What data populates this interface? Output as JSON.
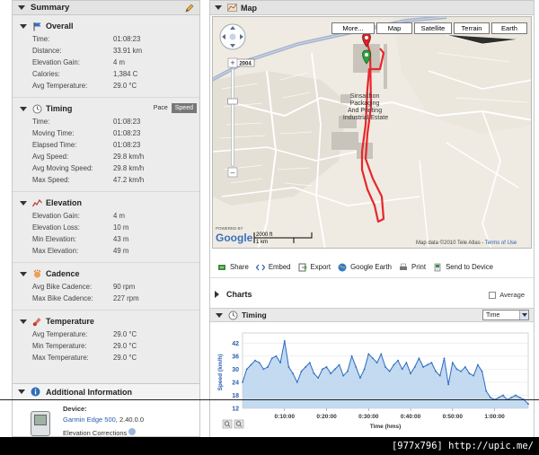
{
  "summary": {
    "title": "Summary",
    "sections": [
      {
        "title": "Overall",
        "icon": "flag-icon",
        "rows": [
          {
            "label": "Time:",
            "value": "01:08:23"
          },
          {
            "label": "Distance:",
            "value": "33.91 km"
          },
          {
            "label": "Elevation Gain:",
            "value": "4 m"
          },
          {
            "label": "Calories:",
            "value": "1,384 C"
          },
          {
            "label": "Avg Temperature:",
            "value": "29.0 °C"
          }
        ]
      },
      {
        "title": "Timing",
        "icon": "clock-icon",
        "toggle": {
          "pace": "Pace",
          "speed": "Speed"
        },
        "rows": [
          {
            "label": "Time:",
            "value": "01:08:23"
          },
          {
            "label": "Moving Time:",
            "value": "01:08:23"
          },
          {
            "label": "Elapsed Time:",
            "value": "01:08:23"
          },
          {
            "label": "Avg Speed:",
            "value": "29.8 km/h"
          },
          {
            "label": "Avg Moving Speed:",
            "value": "29.8 km/h"
          },
          {
            "label": "Max Speed:",
            "value": "47.2 km/h"
          }
        ]
      },
      {
        "title": "Elevation",
        "icon": "elevation-icon",
        "rows": [
          {
            "label": "Elevation Gain:",
            "value": "4 m"
          },
          {
            "label": "Elevation Loss:",
            "value": "10 m"
          },
          {
            "label": "Min Elevation:",
            "value": "43 m"
          },
          {
            "label": "Max Elevation:",
            "value": "49 m"
          }
        ]
      },
      {
        "title": "Cadence",
        "icon": "cadence-icon",
        "rows": [
          {
            "label": "Avg Bike Cadence:",
            "value": "90 rpm"
          },
          {
            "label": "Max Bike Cadence:",
            "value": "227 rpm"
          }
        ]
      },
      {
        "title": "Temperature",
        "icon": "thermometer-icon",
        "rows": [
          {
            "label": "Avg Temperature:",
            "value": "29.0 °C"
          },
          {
            "label": "Min Temperature:",
            "value": "29.0 °C"
          },
          {
            "label": "Max Temperature:",
            "value": "29.0 °C"
          }
        ]
      }
    ]
  },
  "additional_info": {
    "title": "Additional Information",
    "device_label": "Device:",
    "device_name": "Garmin Edge 500",
    "device_version": ", 2.40.0.0",
    "elevation_corrections": "Elevation Corrections"
  },
  "map": {
    "title": "Map",
    "types": [
      "More...",
      "Map",
      "Satellite",
      "Terrain",
      "Earth"
    ],
    "place_label_lines": [
      "Sinsakhon",
      "Packaging",
      "And Printing",
      "Industrial Estate"
    ],
    "road_shield": "2004",
    "powered_by": "POWERED BY",
    "google": "Google",
    "scale_ft": "2000 ft",
    "scale_km": "1 km",
    "copyright": "Map data ©2010 Tele Atlas - ",
    "terms": "Terms of Use",
    "route_color": "#e8262b"
  },
  "share_bar": {
    "share": "Share",
    "embed": "Embed",
    "export": "Export",
    "google_earth": "Google Earth",
    "print": "Print",
    "send_to_device": "Send to Device"
  },
  "charts": {
    "title": "Charts",
    "average": "Average",
    "timing_title": "Timing",
    "x_select": "Time"
  },
  "chart_data": {
    "type": "area",
    "ylabel": "Speed (km/h)",
    "xlabel": "Time (hms)",
    "yticks": [
      12,
      18,
      24,
      30,
      36,
      42
    ],
    "ylim": [
      12,
      45
    ],
    "xticks": [
      "0:10:00",
      "0:20:00",
      "0:30:00",
      "0:40:00",
      "0:50:00",
      "1:00:00"
    ],
    "x_minutes": [
      0,
      1,
      2,
      3,
      4,
      5,
      6,
      7,
      8,
      9,
      10,
      11,
      12,
      13,
      14,
      15,
      16,
      17,
      18,
      19,
      20,
      21,
      22,
      23,
      24,
      25,
      26,
      27,
      28,
      29,
      30,
      31,
      32,
      33,
      34,
      35,
      36,
      37,
      38,
      39,
      40,
      41,
      42,
      43,
      44,
      45,
      46,
      47,
      48,
      49,
      50,
      51,
      52,
      53,
      54,
      55,
      56,
      57,
      58,
      59,
      60,
      61,
      62,
      63,
      64,
      65,
      66,
      67,
      68
    ],
    "values": [
      24,
      30,
      32,
      34,
      33,
      30,
      31,
      35,
      36,
      33,
      43,
      31,
      28,
      24,
      29,
      31,
      33,
      28,
      26,
      30,
      31,
      28,
      30,
      32,
      27,
      29,
      36,
      31,
      26,
      30,
      37,
      35,
      33,
      37,
      31,
      29,
      32,
      34,
      30,
      33,
      28,
      31,
      35,
      31,
      32,
      33,
      29,
      27,
      35,
      23,
      33,
      30,
      29,
      31,
      28,
      27,
      32,
      29,
      20,
      17,
      16,
      17,
      18,
      16,
      17,
      18,
      17,
      16,
      14
    ],
    "color": "#2a6ac2",
    "fill": "#bcd6ee"
  },
  "footer": {
    "text": "[977x796] http://upic.me/"
  }
}
